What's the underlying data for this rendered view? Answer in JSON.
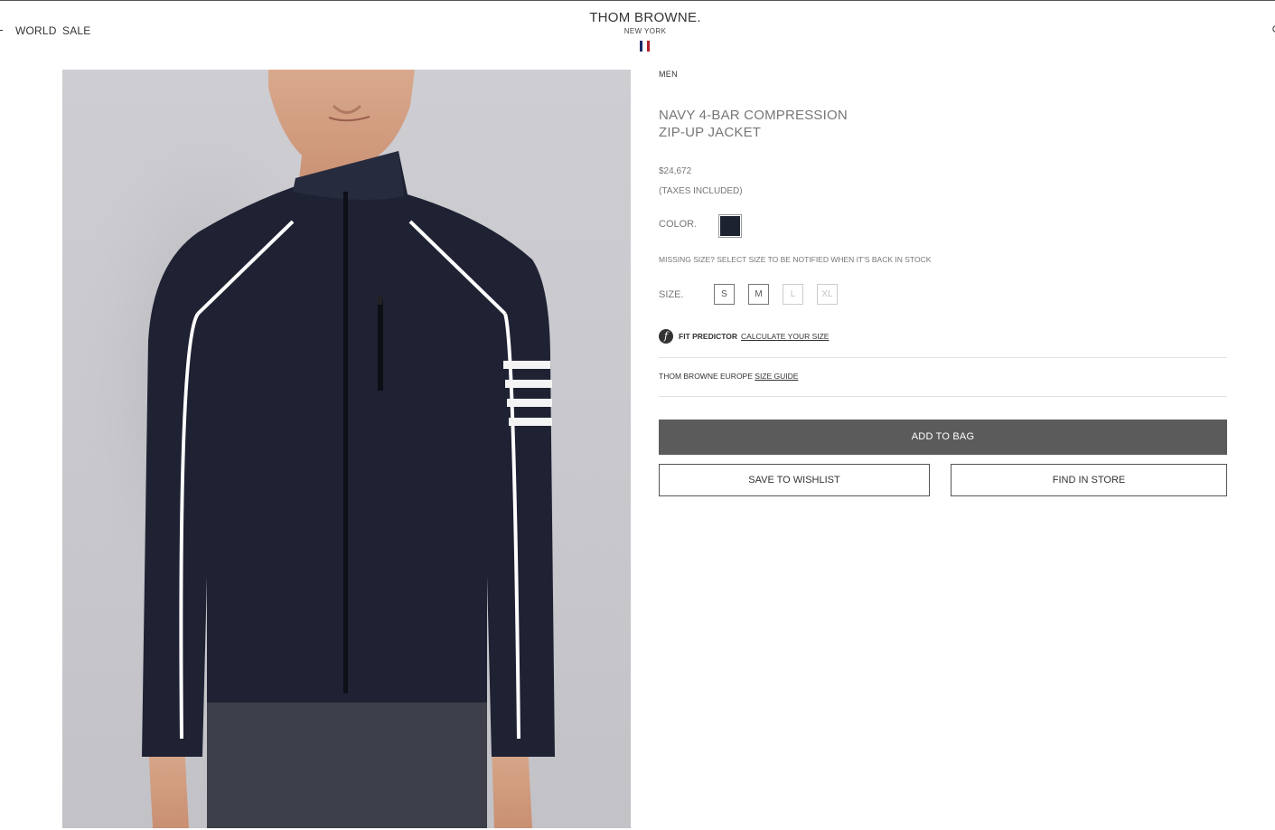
{
  "header": {
    "nav_left": [
      "WORLD",
      "SALE"
    ],
    "brand_name": "THOM BROWNE.",
    "brand_sub": "NEW YORK",
    "flag_colors": [
      "#1b2a6b",
      "#ffffff",
      "#b51f2b"
    ]
  },
  "product": {
    "image_alt": "Navy 4-bar compression zip-up jacket worn by model",
    "breadcrumb": "MEN",
    "title": "NAVY 4-BAR COMPRESSION ZIP-UP JACKET",
    "price": "$24,672",
    "tax_note": "(TAXES INCLUDED)",
    "color_label": "COLOR.",
    "color_swatch": "#1c2230",
    "missing_size_note": "MISSING SIZE? SELECT SIZE TO BE NOTIFIED WHEN IT'S BACK IN STOCK",
    "size_label": "SIZE.",
    "sizes": [
      {
        "label": "S",
        "available": true
      },
      {
        "label": "M",
        "available": true
      },
      {
        "label": "L",
        "available": false
      },
      {
        "label": "XL",
        "available": false
      }
    ],
    "fit_predictor": {
      "icon": "f",
      "label": "FIT PREDICTOR",
      "link": "CALCULATE YOUR SIZE"
    },
    "size_guide": {
      "prefix": "THOM BROWNE EUROPE",
      "link": "SIZE GUIDE"
    },
    "add_to_bag": "ADD TO BAG",
    "save_to_wishlist": "SAVE TO WISHLIST",
    "find_in_store": "FIND IN STORE"
  }
}
